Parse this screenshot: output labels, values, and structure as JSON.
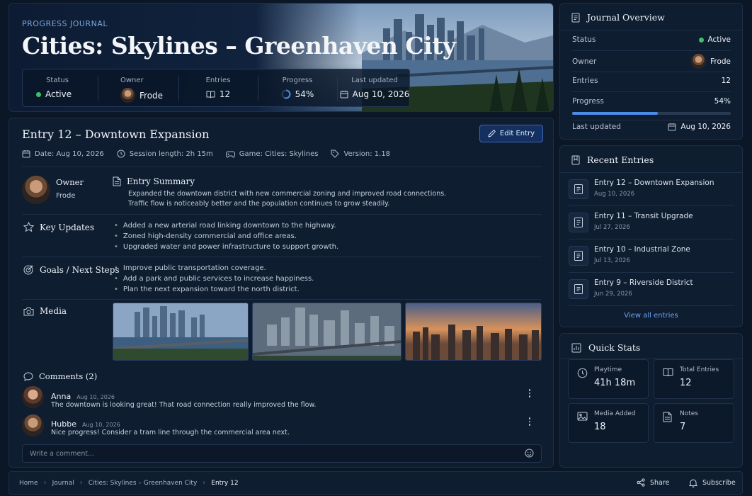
{
  "hero": {
    "eyebrow": "PROGRESS JOURNAL",
    "title": "Cities: Skylines – Greenhaven City",
    "stats": {
      "status_label": "Status",
      "status_value": "Active",
      "owner_label": "Owner",
      "owner_value": "Frode",
      "entries_label": "Entries",
      "entries_value": "12",
      "progress_label": "Progress",
      "progress_value": "54%",
      "updated_label": "Last updated",
      "updated_value": "Aug 10, 2026"
    }
  },
  "entry": {
    "title": "Entry 12 – Downtown Expansion",
    "edit_label": "Edit Entry",
    "meta": {
      "date": "Date: Aug 10, 2026",
      "session": "Session length: 2h 15m",
      "game": "Game: Cities: Skylines",
      "version": "Version: 1.18"
    },
    "owner_label": "Owner",
    "owner_name": "Frode",
    "summary_title": "Entry Summary",
    "summary_lines": [
      "Expanded the downtown district with new commercial zoning and improved road connections.",
      "Traffic flow is noticeably better and the population continues to grow steadily."
    ],
    "key_updates_title": "Key Updates",
    "key_updates": [
      "Added a new arterial road linking downtown to the highway.",
      "Zoned high-density commercial and office areas.",
      "Upgraded water and power infrastructure to support growth."
    ],
    "goals_title": "Goals / Next Steps",
    "goals": [
      "Improve public transportation coverage.",
      "Add a park and public services to increase happiness.",
      "Plan the next expansion toward the north district."
    ],
    "media_title": "Media",
    "comments_title": "Comments (2)",
    "comments": [
      {
        "name": "Anna",
        "date": "Aug 10, 2026",
        "text": "The downtown is looking great! That road connection really improved the flow."
      },
      {
        "name": "Hubbe",
        "date": "Aug 10, 2026",
        "text": "Nice progress! Consider a tram line through the commercial area next."
      }
    ],
    "comment_placeholder": "Write a comment..."
  },
  "overview": {
    "title": "Journal Overview",
    "status_label": "Status",
    "status_value": "Active",
    "owner_label": "Owner",
    "owner_value": "Frode",
    "entries_label": "Entries",
    "entries_value": "12",
    "progress_label": "Progress",
    "progress_value": "54%",
    "progress_fraction": 0.54,
    "updated_label": "Last updated",
    "updated_value": "Aug 10, 2026"
  },
  "recent": {
    "title": "Recent Entries",
    "items": [
      {
        "title": "Entry 12 – Downtown Expansion",
        "date": "Aug 10, 2026"
      },
      {
        "title": "Entry 11 – Transit Upgrade",
        "date": "Jul 27, 2026"
      },
      {
        "title": "Entry 10 – Industrial Zone",
        "date": "Jul 13, 2026"
      },
      {
        "title": "Entry 9 – Riverside District",
        "date": "Jun 29, 2026"
      }
    ],
    "view_all": "View all entries"
  },
  "quick": {
    "title": "Quick Stats",
    "playtime_label": "Playtime",
    "playtime_value": "41h 18m",
    "total_label": "Total Entries",
    "total_value": "12",
    "media_label": "Media Added",
    "media_value": "18",
    "notes_label": "Notes",
    "notes_value": "7"
  },
  "footer": {
    "crumbs": [
      "Home",
      "Journal",
      "Cities: Skylines – Greenhaven City",
      "Entry 12"
    ],
    "share": "Share",
    "subscribe": "Subscribe"
  },
  "colors": {
    "background": "#0b1626",
    "card": "#0f1d31",
    "accent": "#4a8ce8",
    "status_active": "#3fbf6a"
  }
}
